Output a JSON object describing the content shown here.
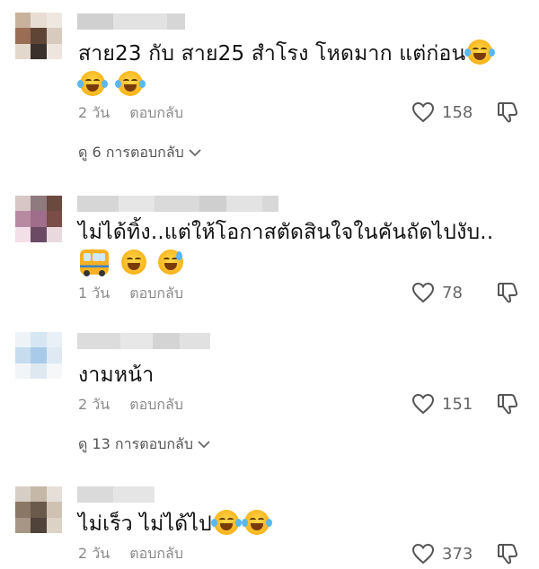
{
  "comments": [
    {
      "text": "สาย23 กับ สาย25 สำโรง โหดมาก แต่ก่อน",
      "time": "2 วัน",
      "reply_label": "ตอบกลับ",
      "likes": "158",
      "view_replies": "ดู 6 การตอบกลับ"
    },
    {
      "text": "ไม่ได้ทิ้ง..แต่ให้โอกาสตัดสินใจในคันถัดไปงับ..",
      "time": "1 วัน",
      "reply_label": "ตอบกลับ",
      "likes": "78"
    },
    {
      "text": "งามหน้า",
      "time": "2 วัน",
      "reply_label": "ตอบกลับ",
      "likes": "151",
      "view_replies": "ดู 13 การตอบกลับ"
    },
    {
      "text": "ไม่เร็ว ไม่ได้ไป",
      "time": "2 วัน",
      "reply_label": "ตอบกลับ",
      "likes": "373"
    }
  ],
  "icons": {
    "like": "heart-outline-icon",
    "dislike": "thumbs-down-icon",
    "expand": "chevron-down-icon"
  },
  "colors": {
    "meta_text": "#8a8a8a",
    "reply_link": "#555555"
  }
}
